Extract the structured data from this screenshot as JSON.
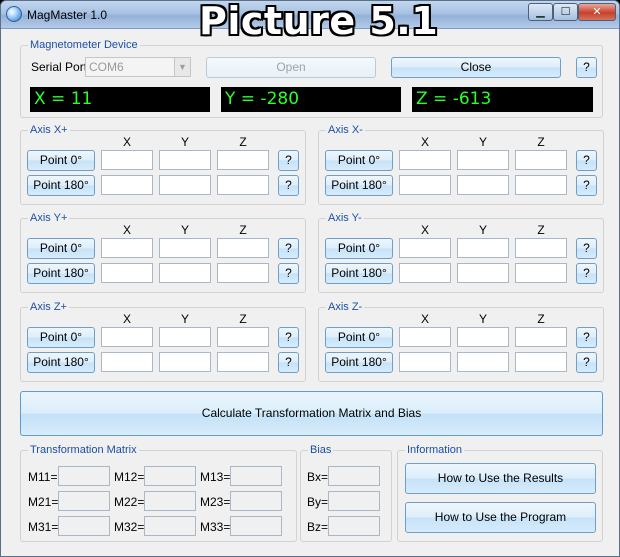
{
  "window": {
    "title": "MagMaster 1.0"
  },
  "overlay": {
    "caption": "Picture 5.1"
  },
  "device": {
    "group_label": "Magnetometer Device",
    "serial_label": "Serial Port:",
    "serial_value": "COM6",
    "open_label": "Open",
    "close_label": "Close",
    "help": "?",
    "x_readout": "X = 11",
    "y_readout": "Y = -280",
    "z_readout": "Z = -613"
  },
  "axes": {
    "col_x": "X",
    "col_y": "Y",
    "col_z": "Z",
    "point0": "Point 0°",
    "point180": "Point 180°",
    "help": "?",
    "xp": "Axis X+",
    "xm": "Axis X-",
    "yp": "Axis Y+",
    "ym": "Axis Y-",
    "zp": "Axis Z+",
    "zm": "Axis Z-"
  },
  "calc_button": "Calculate Transformation Matrix and Bias",
  "matrix": {
    "group_label": "Transformation Matrix",
    "m11": "M11=",
    "m12": "M12=",
    "m13": "M13=",
    "m21": "M21=",
    "m22": "M22=",
    "m23": "M23=",
    "m31": "M31=",
    "m32": "M32=",
    "m33": "M33="
  },
  "bias": {
    "group_label": "Bias",
    "bx": "Bx=",
    "by": "By=",
    "bz": "Bz="
  },
  "info": {
    "group_label": "Information",
    "results_button": "How to Use the Results",
    "program_button": "How to Use the Program"
  }
}
